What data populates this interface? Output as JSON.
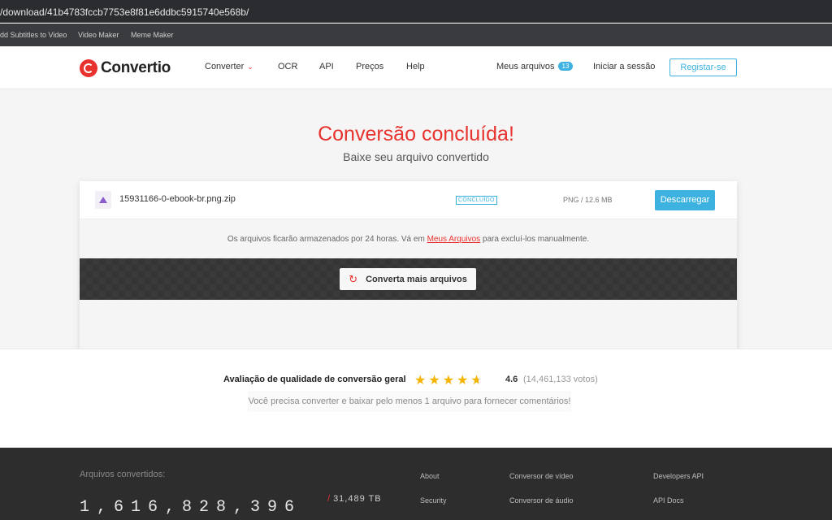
{
  "browser": {
    "url": "/download/41b4783fccb7753e8f81e6ddbc5915740e568b/",
    "bookmarks": [
      "dd Subtitles to Video",
      "Video Maker",
      "Meme Maker"
    ]
  },
  "header": {
    "logo_text": "Convertio",
    "nav": {
      "converter": "Converter",
      "ocr": "OCR",
      "api": "API",
      "precos": "Preços",
      "help": "Help"
    },
    "my_files_label": "Meus arquivos",
    "my_files_count": "13",
    "login_label": "Iniciar a sessão",
    "register_label": "Registar-se"
  },
  "main": {
    "title": "Conversão concluída!",
    "subtitle": "Baixe seu arquivo convertido",
    "file": {
      "name": "15931166-0-ebook-br.png.zip",
      "status": "CONCLUÍDO",
      "format_size": "PNG / 12.6 MB",
      "download_label": "Descarregar"
    },
    "info": {
      "before": "Os arquivos ficarão armazenados por 24 horas. Vá em ",
      "link": "Meus Arquivos",
      "after": " para excluí-los manualmente."
    },
    "convert_more_label": "Converta mais arquivos"
  },
  "rating": {
    "label": "Avaliação de qualidade de conversão geral",
    "score": "4.6",
    "votes": "(14,461,133 votos)",
    "note": "Você precisa converter e baixar pelo menos 1 arquivo para fornecer comentários!"
  },
  "footer": {
    "converted_label": "Arquivos convertidos:",
    "counter": "1,616,828,396",
    "tb": "31,489 TB",
    "links": {
      "about": "About",
      "security": "Security",
      "video": "Conversor de vídeo",
      "audio": "Conversor de áudio",
      "dev_api": "Developers API",
      "api_docs": "API Docs"
    }
  },
  "colors": {
    "brand_red": "#e8322e",
    "accent_blue": "#3db2e0",
    "star": "#f5b400"
  }
}
